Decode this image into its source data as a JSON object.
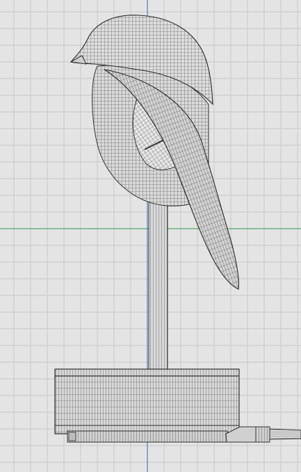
{
  "viewport": {
    "view_mode": "wireframe",
    "grid_visible": true,
    "axes": {
      "x_axis_color": "#2e9a4b",
      "y_axis_color": "#2f66b8"
    },
    "colors": {
      "background": "#e4e4e4",
      "grid": "#c9c9c9",
      "wire": "#3a3a3a",
      "wire_light": "#6e6e6e",
      "fill": "#d9d9d9",
      "fill_dark": "#bdbdbd"
    }
  },
  "model": {
    "object_type": "bird-shaped lamp",
    "parts": [
      "bird-head",
      "bird-body",
      "bird-wing",
      "bird-beak",
      "stand-pole",
      "round-base",
      "power-cable"
    ]
  }
}
